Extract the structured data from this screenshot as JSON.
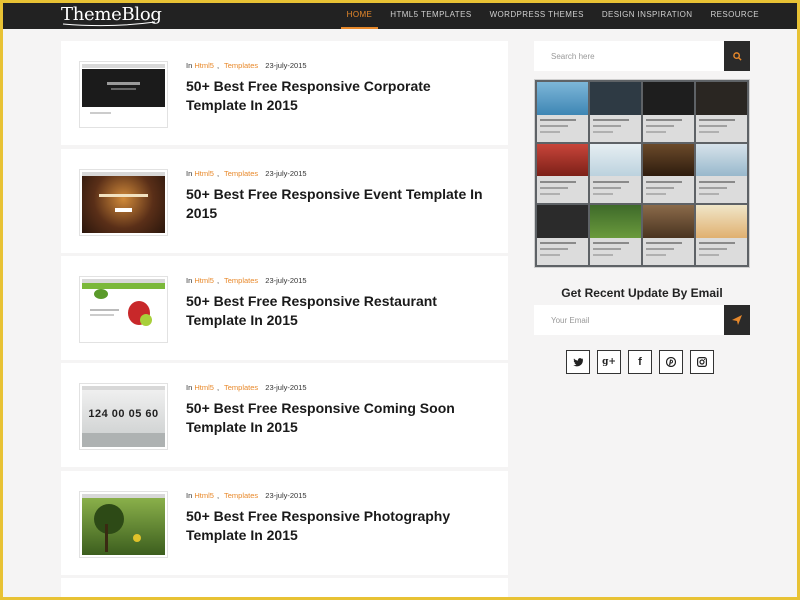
{
  "brand": {
    "logo": "ThemeBlog"
  },
  "nav": [
    {
      "label": "HOME",
      "active": true
    },
    {
      "label": "HTML5 TEMPLATES",
      "active": false
    },
    {
      "label": "WORDPRESS THEMES",
      "active": false
    },
    {
      "label": "DESIGN INSPIRATION",
      "active": false
    },
    {
      "label": "RESOURCE",
      "active": false
    }
  ],
  "posts": [
    {
      "prefix": "In",
      "cat1": "Html5",
      "cat2": "Templates",
      "date": "23-july-2015",
      "title": "50+ Best Free Responsive Corporate Template In 2015"
    },
    {
      "prefix": "In",
      "cat1": "Html5",
      "cat2": "Templates",
      "date": "23-july-2015",
      "title": "50+ Best Free Responsive Event Template In 2015"
    },
    {
      "prefix": "In",
      "cat1": "Html5",
      "cat2": "Templates",
      "date": "23-july-2015",
      "title": "50+ Best Free Responsive Restaurant Template In 2015"
    },
    {
      "prefix": "In",
      "cat1": "Html5",
      "cat2": "Templates",
      "date": "23-july-2015",
      "title": "50+ Best Free Responsive Coming Soon Template In 2015"
    },
    {
      "prefix": "In",
      "cat1": "Html5",
      "cat2": "Templates",
      "date": "23-july-2015",
      "title": "50+ Best Free Responsive Photography Template In 2015"
    }
  ],
  "countdown": "124 00 05 60",
  "sidebar": {
    "search_placeholder": "Search here",
    "email_heading": "Get Recent Update By Email",
    "email_placeholder": "Your Email",
    "social_icons": [
      "twitter-icon",
      "google-plus-icon",
      "facebook-icon",
      "pinterest-icon",
      "instagram-icon"
    ]
  },
  "colors": {
    "accent": "#e8892b",
    "topbar": "#222222",
    "border": "#e8c234"
  }
}
